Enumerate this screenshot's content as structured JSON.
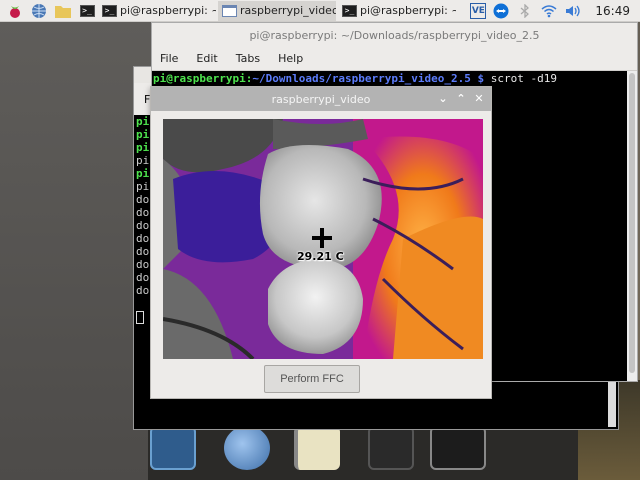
{
  "taskbar": {
    "tasks": [
      {
        "label": "pi@raspberrypi: ~..."
      },
      {
        "label": "raspberrypi_video"
      },
      {
        "label": "pi@raspberrypi: ~..."
      }
    ],
    "clock": "16:49",
    "tray_tags": {
      "vnc": "VE"
    }
  },
  "main_terminal": {
    "title": "pi@raspberrypi: ~/Downloads/raspberrypi_video_2.5",
    "menu": [
      "File",
      "Edit",
      "Tabs",
      "Help"
    ],
    "prompt_user": "pi@raspberrypi",
    "prompt_sep": ":",
    "prompt_path": "~/Downloads/raspberrypi_video_2.5",
    "prompt_symbol": " $ ",
    "command": "scrot -d19"
  },
  "back_terminal": {
    "menu_initial": "F",
    "lines": [
      {
        "text": "pi",
        "style": "green"
      },
      {
        "text": "pi",
        "style": "green"
      },
      {
        "text": "pi",
        "style": "green"
      },
      {
        "text": "pi",
        "style": "white"
      },
      {
        "text": "pi",
        "style": "green"
      },
      {
        "text": "pi",
        "style": "white"
      },
      {
        "text": "do",
        "style": "white"
      },
      {
        "text": "do",
        "style": "white"
      },
      {
        "text": "do",
        "style": "white"
      },
      {
        "text": "do",
        "style": "white"
      },
      {
        "text": "do",
        "style": "white"
      },
      {
        "text": "do",
        "style": "white"
      },
      {
        "text": "do",
        "style": "white"
      },
      {
        "text": "do",
        "style": "white"
      }
    ]
  },
  "video_window": {
    "title": "raspberrypi_video",
    "temperature": "29.21 C",
    "ffc_button": "Perform FFC"
  },
  "colors": {
    "taskbar_bg": "#edebe9",
    "prompt_green": "#4ee44e",
    "prompt_blue": "#5c7cfa",
    "thermal_hot": "#ff8c1a",
    "thermal_mid": "#c2188c",
    "thermal_cool": "#3a1a8a"
  }
}
